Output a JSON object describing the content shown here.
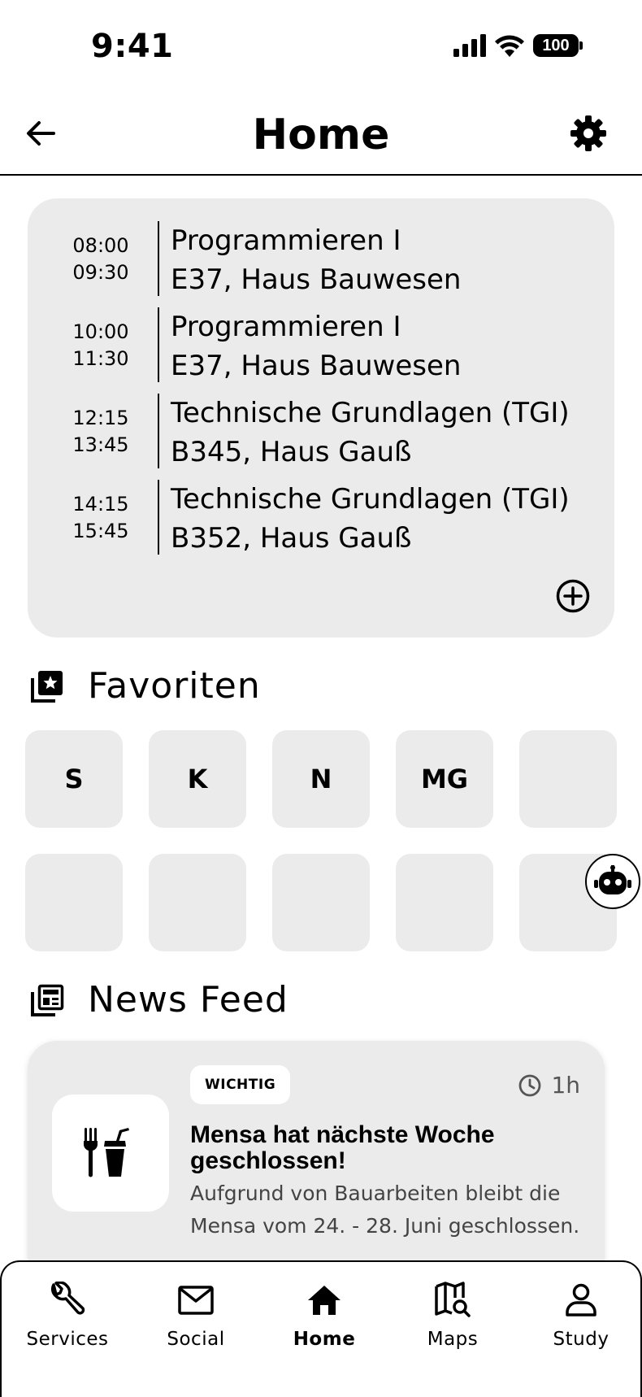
{
  "status_bar": {
    "time": "9:41",
    "battery": "100"
  },
  "header": {
    "title": "Home"
  },
  "schedule": {
    "lessons": [
      {
        "start": "08:00",
        "end": "09:30",
        "course": "Programmieren I",
        "room": "E37, Haus Bauwesen"
      },
      {
        "start": "10:00",
        "end": "11:30",
        "course": "Programmieren I",
        "room": "E37, Haus Bauwesen"
      },
      {
        "start": "12:15",
        "end": "13:45",
        "course": "Technische Grundlagen (TGI)",
        "room": "B345, Haus Gauß"
      },
      {
        "start": "14:15",
        "end": "15:45",
        "course": "Technische Grundlagen (TGI)",
        "room": "B352, Haus Gauß"
      }
    ]
  },
  "favorites": {
    "heading": "Favoriten",
    "tiles": [
      "S",
      "K",
      "N",
      "MG",
      "",
      "",
      "",
      "",
      "",
      ""
    ]
  },
  "news": {
    "heading": "News Feed",
    "items": [
      {
        "badge": "WICHTIG",
        "time": "1h",
        "title": "Mensa hat nächste Woche geschlossen!",
        "body": "Aufgrund von Bauarbeiten bleibt die Mensa vom 24. - 28. Juni geschlossen."
      }
    ]
  },
  "nav": {
    "items": [
      {
        "label": "Services",
        "icon": "wrench-icon"
      },
      {
        "label": "Social",
        "icon": "mail-icon"
      },
      {
        "label": "Home",
        "icon": "home-icon",
        "active": true
      },
      {
        "label": "Maps",
        "icon": "map-search-icon"
      },
      {
        "label": "Study",
        "icon": "person-icon"
      }
    ]
  },
  "colors": {
    "card_bg": "#ebebeb",
    "text": "#000000",
    "muted": "#555555"
  }
}
